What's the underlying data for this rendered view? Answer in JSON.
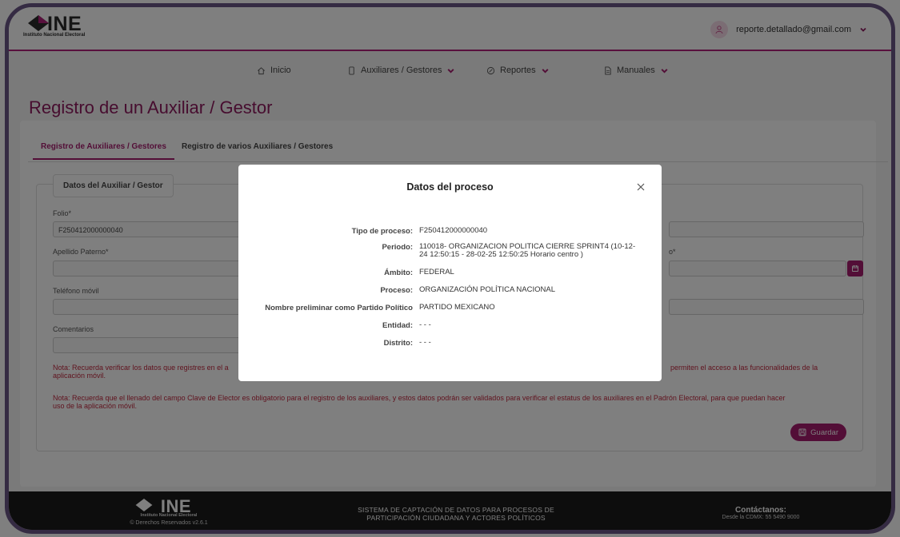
{
  "header": {
    "logo_text": "INE",
    "logo_subtitle": "Instituto Nacional Electoral",
    "user_email": "reporte.detallado@gmail.com"
  },
  "nav": {
    "items": [
      {
        "label": "Inicio",
        "icon": "home-icon"
      },
      {
        "label": "Auxiliares / Gestores",
        "icon": "phone-icon",
        "dropdown": true
      },
      {
        "label": "Reportes",
        "icon": "clock-icon",
        "dropdown": true
      },
      {
        "label": "Manuales",
        "icon": "document-icon",
        "dropdown": true
      }
    ]
  },
  "page": {
    "title": "Registro de un Auxiliar / Gestor"
  },
  "tabs": [
    {
      "label": "Registro de Auxiliares / Gestores",
      "active": true
    },
    {
      "label": "Registro de varios Auxiliares / Gestores",
      "active": false
    }
  ],
  "form": {
    "legend": "Datos del Auxiliar / Gestor",
    "folio_label": "Folio*",
    "folio_value": "F250412000000040",
    "apellido_paterno_label": "Apellido Paterno*",
    "right_label_fragment": "o*",
    "telefono_label": "Teléfono móvil",
    "comentarios_label": "Comentarios",
    "note1_left": "Nota: Recuerda verificar los datos que registres en el a",
    "note1_left_2": "aplicación móvil.",
    "note1_right": "permiten el acceso a las funcionalidades de la",
    "note2": "Nota: Recuerda que el llenado del campo Clave de Elector es obligatorio para el registro de los auxiliares, y estos datos podrán ser validados para verificar el estatus de los auxiliares en el Padrón Electoral, para que puedan hacer",
    "note2_line2": "uso de la aplicación móvil.",
    "save_label": "Guardar"
  },
  "footer": {
    "logo_text": "INE",
    "logo_subtitle": "Instituto Nacional Electoral",
    "rights": "© Derechos Reservados v2.6.1",
    "system_line1": "SISTEMA DE CAPTACIÓN DE DATOS PARA PROCESOS DE",
    "system_line2": "PARTICIPACIÓN CIUDADANA Y ACTORES POLÍTICOS",
    "contact_title": "Contáctanos:",
    "contact_phone": "Desde la CDMX: 55 5490 9000"
  },
  "modal": {
    "title": "Datos del proceso",
    "rows": [
      {
        "key": "Tipo de proceso:",
        "value": "F250412000000040"
      },
      {
        "key": "Periodo:",
        "value": "110018- ORGANIZACION POLITICA CIERRE SPRINT4 (10-12-24 12:50:15 - 28-02-25 12:50:25 Horario centro )"
      },
      {
        "key": "Ámbito:",
        "value": "FEDERAL"
      },
      {
        "key": "Proceso:",
        "value": "ORGANIZACIÓN POLÍTICA NACIONAL"
      },
      {
        "key": "Nombre preliminar como Partido Político",
        "value": "PARTIDO MEXICANO"
      },
      {
        "key": "Entidad:",
        "value": "- - -"
      },
      {
        "key": "Distrito:",
        "value": "- - -"
      }
    ]
  },
  "colors": {
    "accent": "#a61d6e",
    "title": "#8e1a5f",
    "note": "#c1283f",
    "frame": "#6b5687"
  }
}
